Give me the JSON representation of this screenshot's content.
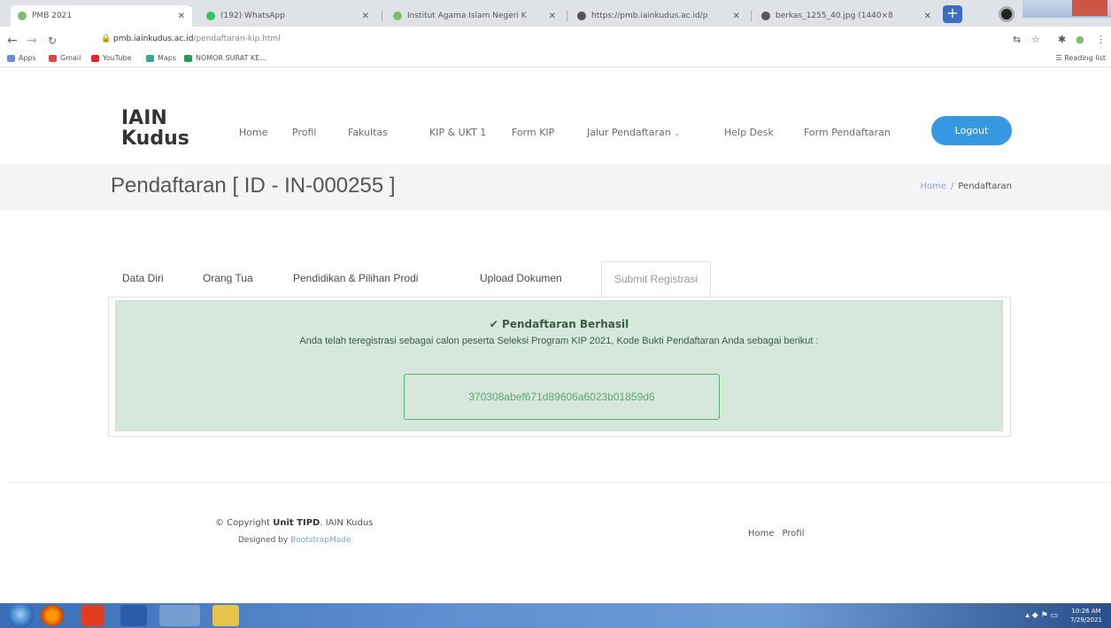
{
  "browser": {
    "tabs": [
      {
        "title": "PMB 2021",
        "active": true
      },
      {
        "title": "(192) WhatsApp",
        "active": false
      },
      {
        "title": "Institut Agama Islam Negeri K",
        "active": false
      },
      {
        "title": "https://pmb.iainkudus.ac.id/p",
        "active": false
      },
      {
        "title": "berkas_1255_40.jpg (1440×8",
        "active": false
      }
    ],
    "url_host": "pmb.iainkudus.ac.id",
    "url_path": "/pendaftaran-kip.html",
    "bookmarks": [
      "Apps",
      "Gmail",
      "YouTube",
      "Maps",
      "NOMOR SURAT KE..."
    ],
    "reading_list": "Reading list"
  },
  "site": {
    "logo_line1": "IAIN",
    "logo_line2": "Kudus",
    "nav": [
      "Home",
      "Profil",
      "Fakultas",
      "KIP & UKT 1",
      "Form KIP",
      "Jalur Pendaftaran",
      "Help Desk",
      "Form Pendaftaran"
    ],
    "logout": "Logout",
    "page_title": "Pendaftaran [ ID - IN-000255 ]",
    "breadcrumb_home": "Home",
    "breadcrumb_sep": "/",
    "breadcrumb_current": "Pendaftaran"
  },
  "form": {
    "tabs": [
      "Data Diri",
      "Orang Tua",
      "Pendidikan & Pilihan Prodi",
      "Upload Dokumen",
      "Submit Registrasi"
    ],
    "active_tab": 4,
    "success_title": "Pendaftaran Berhasil",
    "success_message": "Anda telah teregistrasi sebagai calon peserta Seleksi Program KIP 2021, Kode Bukti Pendaftaran Anda sebagai berikut :",
    "code": "370308abef671d89606a6023b01859d6"
  },
  "footer": {
    "copyright_prefix": "© Copyright",
    "copyright_bold": "Unit TIPD",
    "copyright_suffix": ". IAIN Kudus",
    "designed_prefix": "Designed by",
    "designed_link": "BootstrapMade",
    "nav": [
      "Home",
      "Profil"
    ]
  },
  "taskbar": {
    "time": "10:26 AM",
    "date": "7/29/2021"
  },
  "colors": {
    "accent": "#3599e2",
    "success_bg": "#d6e8dc",
    "code_border": "#58b56a"
  }
}
